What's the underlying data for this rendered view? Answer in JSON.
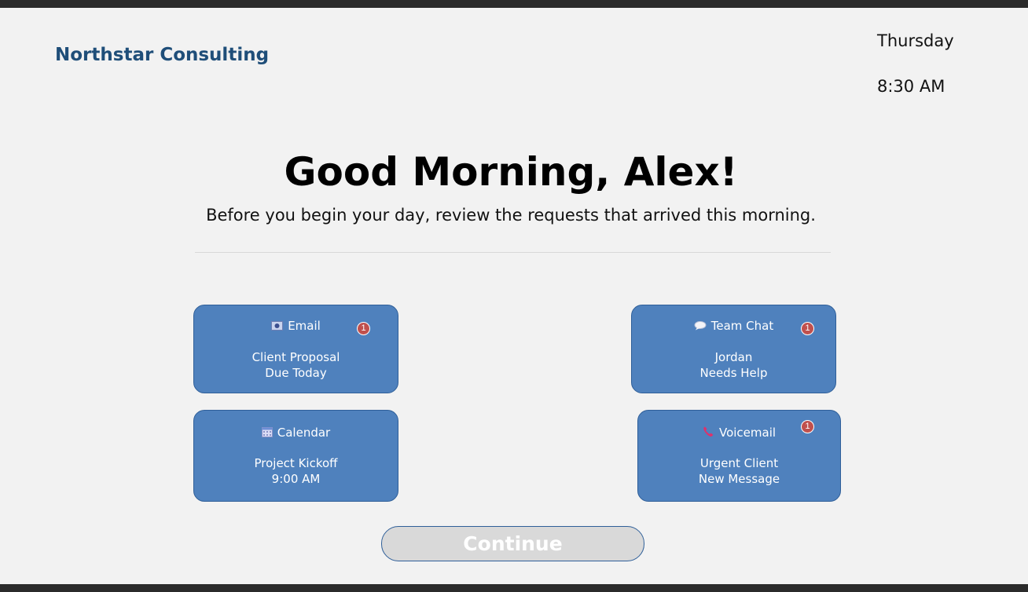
{
  "header": {
    "brand": "Northstar Consulting",
    "day": "Thursday",
    "time": "8:30 AM"
  },
  "hero": {
    "greeting": "Good Morning, Alex!",
    "subtitle": "Before you begin your day, review the requests that arrived this morning."
  },
  "tiles": [
    {
      "title": "Email",
      "icon": "email-icon",
      "line1": "Client Proposal",
      "line2": "Due Today",
      "badge": "1"
    },
    {
      "title": "Team Chat",
      "icon": "chat-bubble-icon",
      "line1": "Jordan",
      "line2": "Needs Help",
      "badge": "1"
    },
    {
      "title": "Calendar",
      "icon": "calendar-icon",
      "line1": "Project Kickoff",
      "line2": "9:00 AM"
    },
    {
      "title": "Voicemail",
      "icon": "phone-icon",
      "line1": "Urgent Client",
      "line2": "New Message",
      "badge": "1"
    }
  ],
  "actions": {
    "continue_label": "Continue"
  },
  "colors": {
    "brand": "#1f4e79",
    "tile": "#4f81bd",
    "badge": "#c0504d",
    "continue_disabled": "#d9d9d9"
  }
}
